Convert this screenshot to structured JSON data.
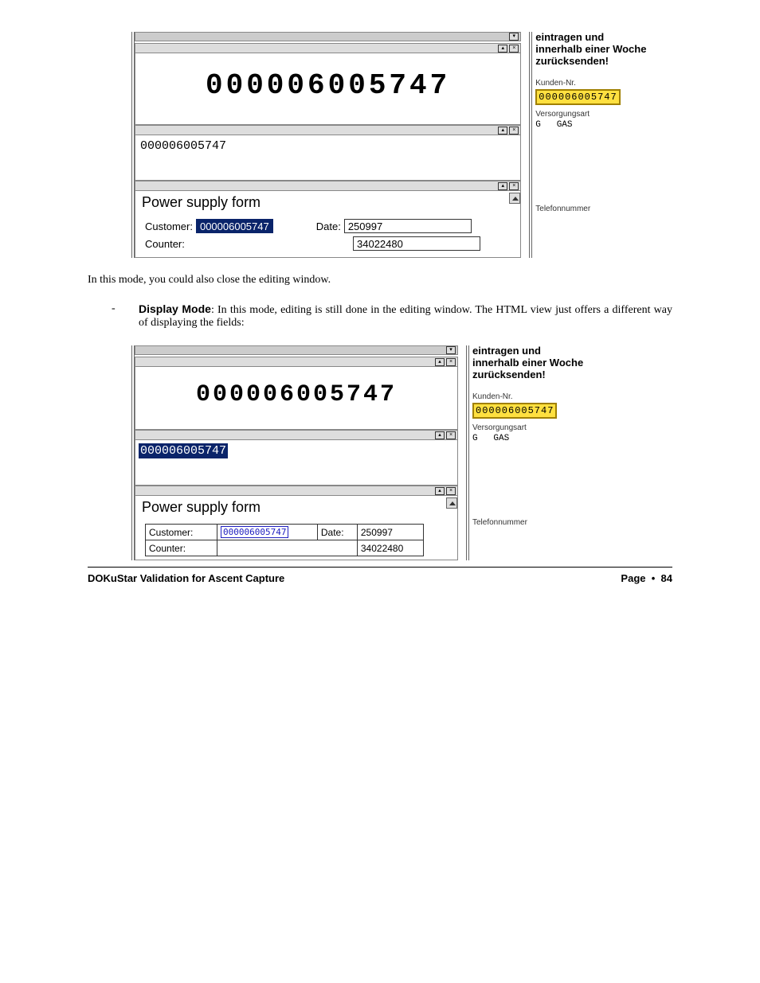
{
  "ocr_number": "000006005747",
  "fig1": {
    "edit_value": "000006005747",
    "form": {
      "title": "Power supply form",
      "customer_label": "Customer:",
      "customer_value": "000006005747",
      "date_label": "Date:",
      "date_value": "250997",
      "counter_label": "Counter:",
      "counter_value": "34022480"
    },
    "right": {
      "heading_l1": "eintragen und",
      "heading_l2": "innerhalb einer Woche",
      "heading_l3": "zurücksenden!",
      "kunden_nr_label": "Kunden-Nr.",
      "kunden_nr_value": "000006005747",
      "versorgungsart_label": "Versorgungsart",
      "gas_code": "G",
      "gas_text": "GAS",
      "telefon_label": "Telefonnummer"
    }
  },
  "para1": "In this mode, you could also close the editing window.",
  "bullet": {
    "dash": "-",
    "label": "Display Mode",
    "text": ": In this mode, editing is still done in the editing window. The HTML view just offers a different way of displaying the fields:"
  },
  "fig2": {
    "edit_value": "000006005747",
    "form": {
      "title": "Power supply form",
      "customer_label": "Customer:",
      "customer_value": "000006005747",
      "date_label": "Date:",
      "date_value": "250997",
      "counter_label": "Counter:",
      "counter_value": "34022480"
    },
    "right": {
      "heading_l1": "eintragen und",
      "heading_l2": "innerhalb einer Woche",
      "heading_l3": "zurücksenden!",
      "kunden_nr_label": "Kunden-Nr.",
      "kunden_nr_value": "000006005747",
      "versorgungsart_label": "Versorgungsart",
      "gas_code": "G",
      "gas_text": "GAS",
      "telefon_label": "Telefonnummer"
    }
  },
  "footer": {
    "left": "DOKuStar Validation for Ascent Capture",
    "right_label": "Page",
    "right_bullet": "•",
    "right_num": "84"
  }
}
